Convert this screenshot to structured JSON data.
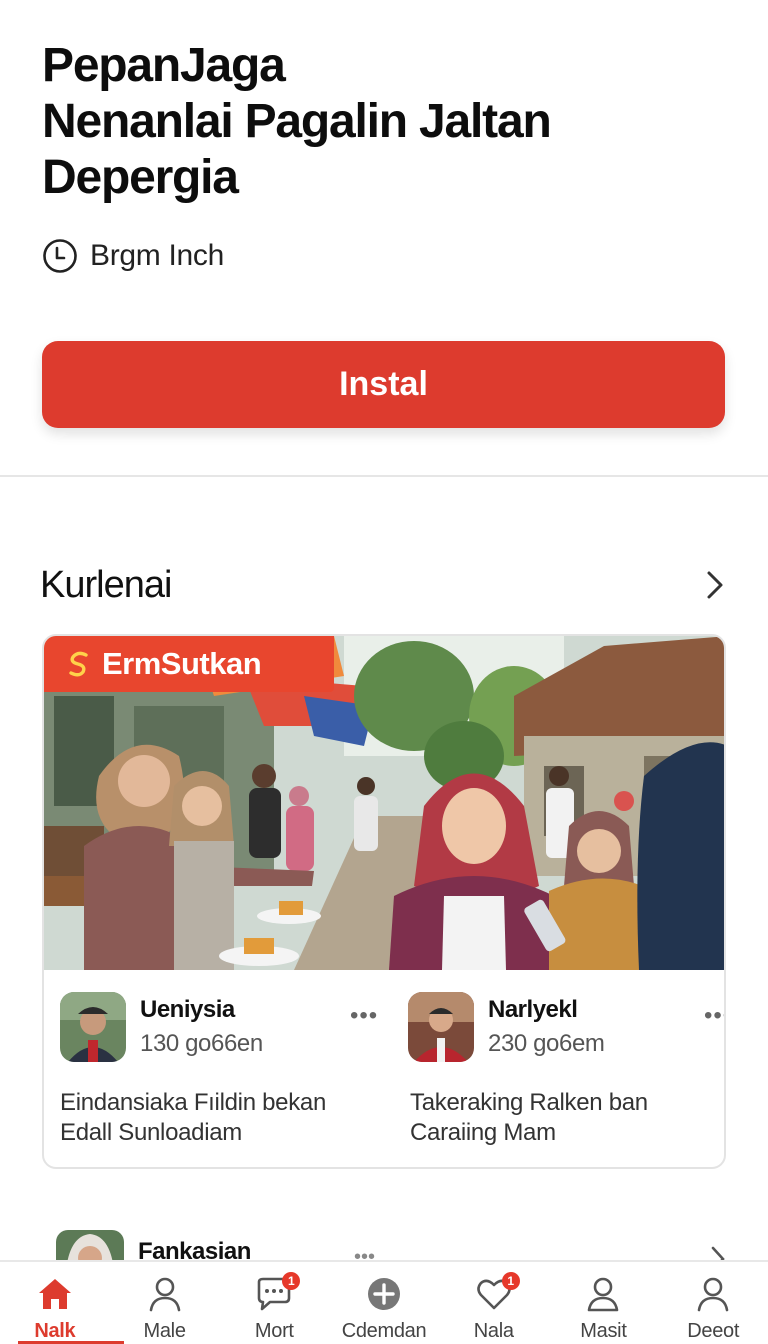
{
  "header": {
    "title_lines": [
      "PepanJaga",
      "Nenanlai Pagalin Jaltan",
      "Depergia"
    ],
    "meta_text": "Brgm Inch",
    "meta_icon": "clock-icon"
  },
  "install_button": {
    "label": "Instal",
    "color": "#dd3b2e"
  },
  "section": {
    "title": "Kurlenai",
    "chevron_icon": "chevron-right-icon"
  },
  "feature_card": {
    "banner_label": "ErmSutkan",
    "banner_icon": "brand-s-icon",
    "banner_color": "#e8462e",
    "authors": [
      {
        "name": "Ueniysia",
        "subtitle": "130 go66en",
        "description": "Eindansiaka Fıildin bekan Edall Sunloadiam"
      },
      {
        "name": "Narlyekl",
        "subtitle": "230 go6em",
        "description": "Takeraking Ralken ban Caraiing Mam"
      }
    ]
  },
  "next_item": {
    "name": "Fankasian"
  },
  "bottom_nav": {
    "items": [
      {
        "label": "Nalk",
        "icon": "home-icon",
        "active": true
      },
      {
        "label": "Male",
        "icon": "person-icon",
        "active": false
      },
      {
        "label": "Mort",
        "icon": "chat-icon",
        "badge": "1",
        "active": false
      },
      {
        "label": "Cdemdan",
        "icon": "plus-circle-icon",
        "active": false
      },
      {
        "label": "Nala",
        "icon": "heart-icon",
        "badge": "1",
        "active": false
      },
      {
        "label": "Masit",
        "icon": "person-icon",
        "active": false
      },
      {
        "label": "Deeot",
        "icon": "person-icon",
        "active": false
      }
    ],
    "accent_color": "#dd3b2e"
  }
}
